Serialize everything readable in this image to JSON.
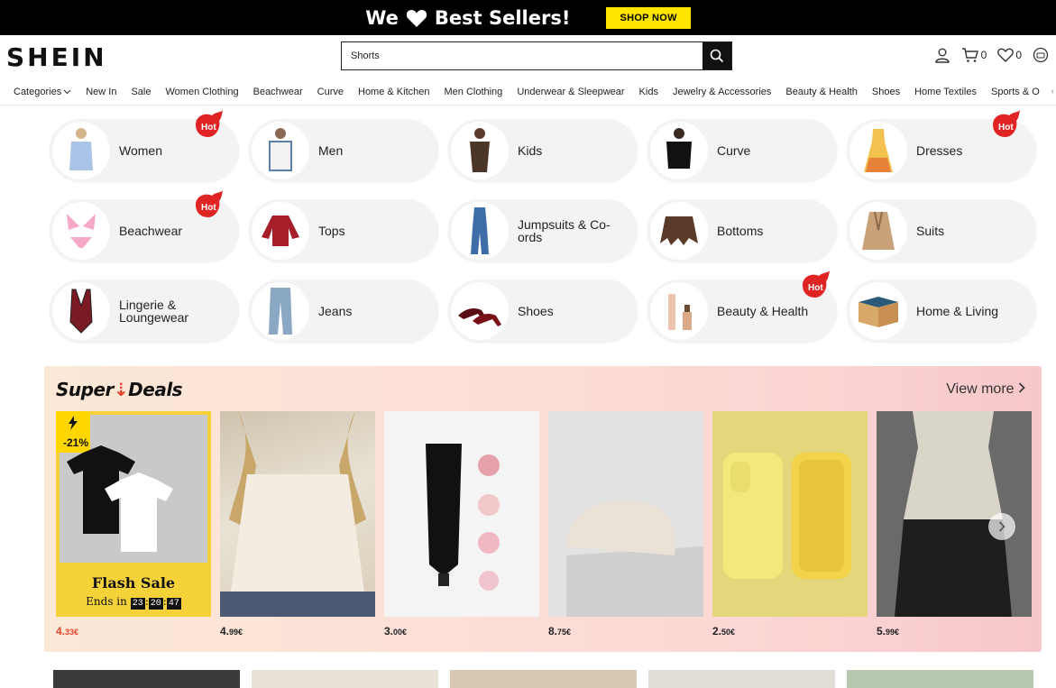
{
  "promo": {
    "text_we": "We",
    "text_best": "Best Sellers!",
    "shop_now": "SHOP NOW"
  },
  "header": {
    "logo": "SHEIN",
    "search_value": "Shorts",
    "cart_count": "0",
    "wishlist_count": "0"
  },
  "nav": {
    "items": [
      "Categories",
      "New In",
      "Sale",
      "Women Clothing",
      "Beachwear",
      "Curve",
      "Home & Kitchen",
      "Men Clothing",
      "Underwear & Sleepwear",
      "Kids",
      "Jewelry & Accessories",
      "Beauty & Health",
      "Shoes",
      "Home Textiles",
      "Sports & O"
    ]
  },
  "categories": [
    {
      "label": "Women",
      "hot": true
    },
    {
      "label": "Men",
      "hot": false
    },
    {
      "label": "Kids",
      "hot": false
    },
    {
      "label": "Curve",
      "hot": false
    },
    {
      "label": "Dresses",
      "hot": true
    },
    {
      "label": "Beachwear",
      "hot": true
    },
    {
      "label": "Tops",
      "hot": false
    },
    {
      "label": "Jumpsuits & Co-ords",
      "hot": false
    },
    {
      "label": "Bottoms",
      "hot": false
    },
    {
      "label": "Suits",
      "hot": false
    },
    {
      "label": "Lingerie & Loungewear",
      "hot": false
    },
    {
      "label": "Jeans",
      "hot": false
    },
    {
      "label": "Shoes",
      "hot": false
    },
    {
      "label": "Beauty & Health",
      "hot": true
    },
    {
      "label": "Home & Living",
      "hot": false
    }
  ],
  "hot_label": "Hot",
  "deals": {
    "title_super": "Super",
    "title_deals": "Deals",
    "view_more": "View more",
    "flash": {
      "pct": "-21%",
      "title": "Flash Sale",
      "ends": "Ends in",
      "h": "23",
      "m": "20",
      "s": "47"
    },
    "products": [
      {
        "int": "4.",
        "dec": "33€",
        "red": true
      },
      {
        "int": "4.",
        "dec": "99€",
        "red": false
      },
      {
        "int": "3.",
        "dec": "00€",
        "red": false
      },
      {
        "int": "8.",
        "dec": "75€",
        "red": false
      },
      {
        "int": "2.",
        "dec": "50€",
        "red": false
      },
      {
        "int": "5.",
        "dec": "99€",
        "red": false
      }
    ]
  },
  "colors": {
    "accent": "#e8432e",
    "promo_btn": "#ffe500",
    "black": "#000000"
  }
}
